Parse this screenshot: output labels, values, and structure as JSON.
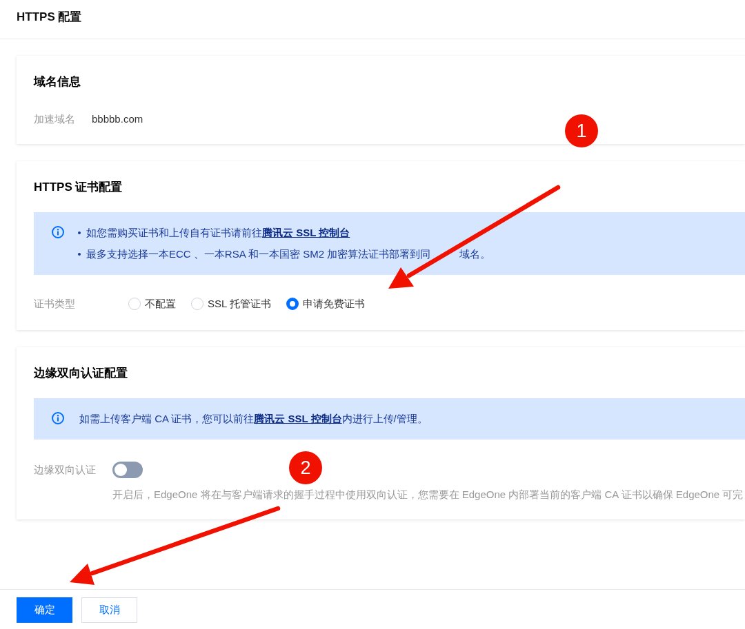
{
  "header": {
    "title": "HTTPS 配置"
  },
  "sections": [
    {
      "title": "域名信息",
      "fields": [
        {
          "label": "加速域名",
          "value": "bbbbb.com"
        }
      ]
    },
    {
      "title": "HTTPS 证书配置",
      "notice": {
        "bulleted": true,
        "items": [
          {
            "text": "如您需购买证书和上传自有证书请前往",
            "link": "腾讯云 SSL 控制台"
          },
          {
            "text": "最多支持选择一本ECC 、一本RSA 和一本国密 SM2 加密算法证书部署到同",
            "text_after_arrow": "域名。"
          }
        ]
      },
      "radio_group": {
        "label": "证书类型",
        "options": [
          {
            "label": "不配置",
            "selected": false
          },
          {
            "label": "SSL 托管证书",
            "selected": false
          },
          {
            "label": "申请免费证书",
            "selected": true
          }
        ]
      }
    },
    {
      "title": "边缘双向认证配置",
      "notice": {
        "bulleted": false,
        "items": [
          {
            "text": "如需上传客户端 CA 证书，您可以前往",
            "link": "腾讯云 SSL 控制台",
            "text_after": "内进行上传/管理。"
          }
        ]
      },
      "toggle": {
        "label": "边缘双向认证",
        "on": false,
        "help": "开启后，EdgeOne 将在与客户端请求的握手过程中使用双向认证，您需要在 EdgeOne 内部署当前的客户端 CA 证书以确保 EdgeOne 可完"
      }
    }
  ],
  "footer": {
    "buttons": [
      {
        "label": "确定",
        "kind": "primary"
      },
      {
        "label": "取消",
        "kind": "secondary"
      }
    ]
  },
  "annotations": [
    {
      "label": "1"
    },
    {
      "label": "2"
    }
  ]
}
